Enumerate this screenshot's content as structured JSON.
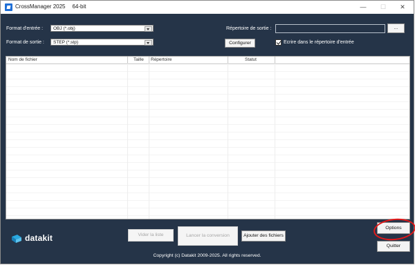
{
  "window": {
    "title": "CrossManager 2025",
    "arch": "64-bit",
    "controls": {
      "minimize": "—",
      "maximize": "☐",
      "close": "✕"
    }
  },
  "form": {
    "input_format_label": "Format d'entrée :",
    "input_format_value": "OBJ (*.obj)",
    "output_format_label": "Format de sortie :",
    "output_format_value": "STEP (*.stp)",
    "output_dir_label": "Répertoire de sortie :",
    "output_dir_value": "",
    "browse_label": "...",
    "configure_label": "Configurer",
    "write_in_input_dir_label": "Ecrire dans le répertoire d'entrée",
    "write_in_input_dir_checked": true
  },
  "table": {
    "columns": [
      "Nom de fichier",
      "Taille",
      "Répertoire",
      "Statut"
    ],
    "rows": []
  },
  "actions": {
    "clear_list": "Vider la liste",
    "start_conversion": "Lancer la conversion",
    "add_files": "Ajouter des fichiers",
    "options": "Options",
    "quit": "Quitter"
  },
  "brand": {
    "logo_text": "datakit",
    "logo_color": "#29a8e0"
  },
  "footer": {
    "copyright": "Copyright (c) Datakit 2009-2025. All rights reserved."
  },
  "colors": {
    "background": "#253448",
    "annotation": "#e21a1a"
  }
}
